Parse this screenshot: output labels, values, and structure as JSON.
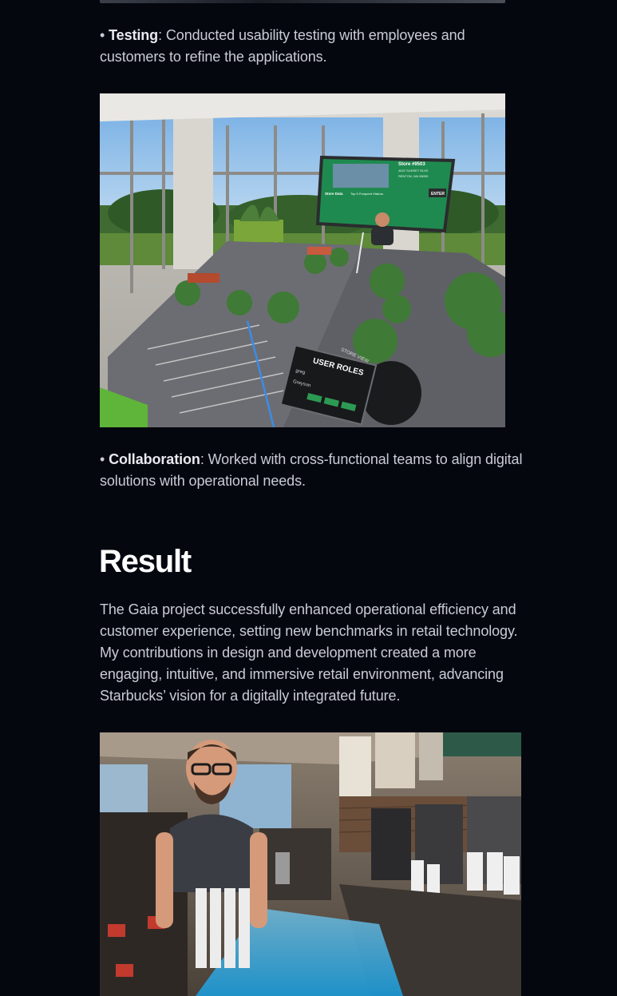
{
  "testing": {
    "bullet": "•",
    "term": "Testing",
    "text": ": Conducted usability testing with employees and customers to refine the applications."
  },
  "vr_scene": {
    "sign_store": "Store #9503",
    "sign_addr1": "4622 SUNSET BLVD",
    "sign_addr2": "RENTON, WA 98059",
    "sign_label1": "Store Data",
    "sign_label2": "Top 5 Frequent Visitors",
    "sign_enter": "ENTER",
    "panel_title": "USER ROLES",
    "panel_side": "STORE VIEW",
    "panel_name1": "greg",
    "panel_name2": "Greyson"
  },
  "collaboration": {
    "bullet": "•",
    "term": "Collaboration",
    "text": ": Worked with cross-functional teams to align digital solutions with operational needs."
  },
  "result": {
    "heading": "Result",
    "text": "The Gaia project successfully enhanced operational efficiency and customer experience, setting new benchmarks in retail technology. My contributions in design and development created a more engaging, intuitive, and immersive retail environment, advancing Starbucks’ vision for a digitally integrated future."
  }
}
